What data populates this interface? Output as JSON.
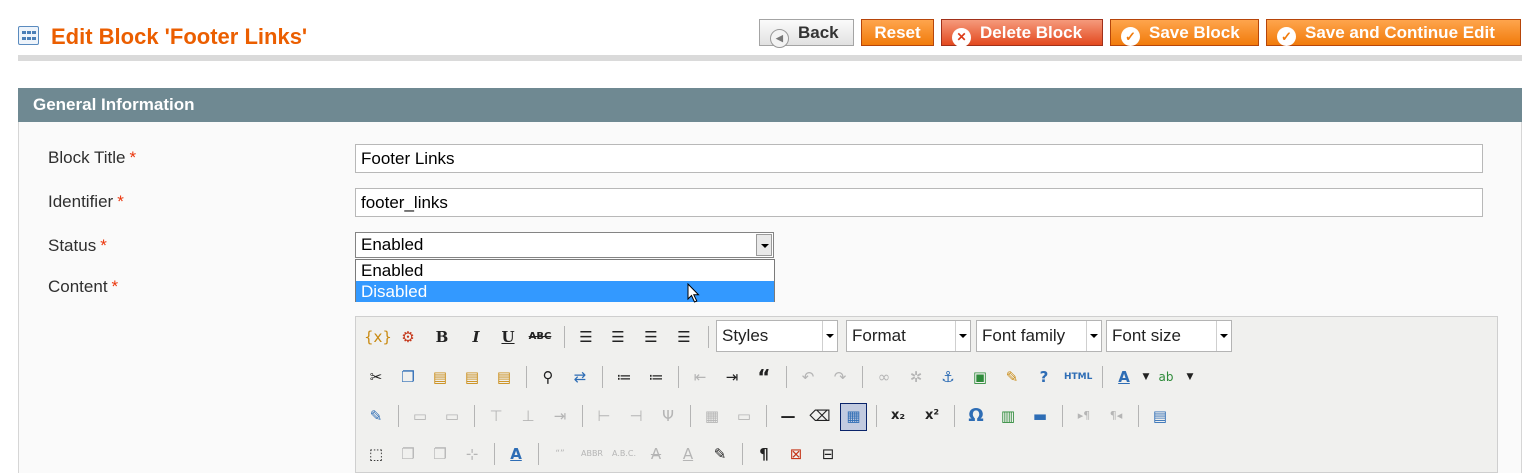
{
  "header": {
    "title": "Edit Block 'Footer Links'",
    "buttons": {
      "back": "Back",
      "reset": "Reset",
      "delete": "Delete Block",
      "save": "Save Block",
      "save_continue": "Save and Continue Edit"
    }
  },
  "section": {
    "title": "General Information"
  },
  "form": {
    "block_title": {
      "label": "Block Title",
      "required_mark": "*",
      "value": "Footer Links"
    },
    "identifier": {
      "label": "Identifier",
      "required_mark": "*",
      "value": "footer_links"
    },
    "status": {
      "label": "Status",
      "required_mark": "*",
      "value": "Enabled",
      "options": [
        "Enabled",
        "Disabled"
      ],
      "highlighted_option": "Disabled"
    },
    "content": {
      "label": "Content",
      "required_mark": "*"
    }
  },
  "editor": {
    "combos": {
      "styles": "Styles",
      "format": "Format",
      "font_family": "Font family",
      "font_size": "Font size"
    },
    "glyphs": {
      "bold": "B",
      "italic": "I",
      "underline": "U",
      "strike": "ABC",
      "html": "HTML",
      "omega": "Ω",
      "pilcrow": "¶",
      "subscript": "x₂",
      "superscript": "x²",
      "quote": "“",
      "anchor": "⚓",
      "help": "?"
    }
  }
}
